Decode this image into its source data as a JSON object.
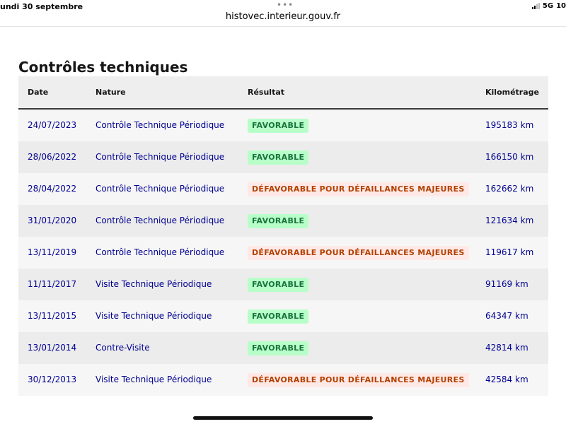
{
  "status_bar": {
    "time_text": "undi 30 septembre",
    "dots": "•••",
    "url": "histovec.interieur.gouv.fr",
    "network": "5G",
    "battery": "10"
  },
  "section": {
    "title": "Contrôles techniques"
  },
  "table": {
    "headers": {
      "date": "Date",
      "nature": "Nature",
      "result": "Résultat",
      "km": "Kilométrage"
    },
    "rows": [
      {
        "date": "24/07/2023",
        "nature": "Contrôle Technique Périodique",
        "result": "FAVORABLE",
        "status": "ok",
        "km": "195183 km"
      },
      {
        "date": "28/06/2022",
        "nature": "Contrôle Technique Périodique",
        "result": "FAVORABLE",
        "status": "ok",
        "km": "166150 km"
      },
      {
        "date": "28/04/2022",
        "nature": "Contrôle Technique Périodique",
        "result": "DÉFAVORABLE POUR DÉFAILLANCES MAJEURES",
        "status": "bad",
        "km": "162662 km"
      },
      {
        "date": "31/01/2020",
        "nature": "Contrôle Technique Périodique",
        "result": "FAVORABLE",
        "status": "ok",
        "km": "121634 km"
      },
      {
        "date": "13/11/2019",
        "nature": "Contrôle Technique Périodique",
        "result": "DÉFAVORABLE POUR DÉFAILLANCES MAJEURES",
        "status": "bad",
        "km": "119617 km"
      },
      {
        "date": "11/11/2017",
        "nature": "Visite Technique Périodique",
        "result": "FAVORABLE",
        "status": "ok",
        "km": "91169 km"
      },
      {
        "date": "13/11/2015",
        "nature": "Visite Technique Périodique",
        "result": "FAVORABLE",
        "status": "ok",
        "km": "64347 km"
      },
      {
        "date": "13/01/2014",
        "nature": "Contre-Visite",
        "result": "FAVORABLE",
        "status": "ok",
        "km": "42814 km"
      },
      {
        "date": "30/12/2013",
        "nature": "Visite Technique Périodique",
        "result": "DÉFAVORABLE POUR DÉFAILLANCES MAJEURES",
        "status": "bad",
        "km": "42584 km"
      }
    ]
  },
  "colors": {
    "link_blue": "#000091",
    "favorable_bg": "#b8fec9",
    "favorable_text": "#18753c",
    "defavorable_bg": "#ffe9e6",
    "defavorable_text": "#b34000"
  },
  "icons": {
    "signal": "signal-bars-icon"
  }
}
